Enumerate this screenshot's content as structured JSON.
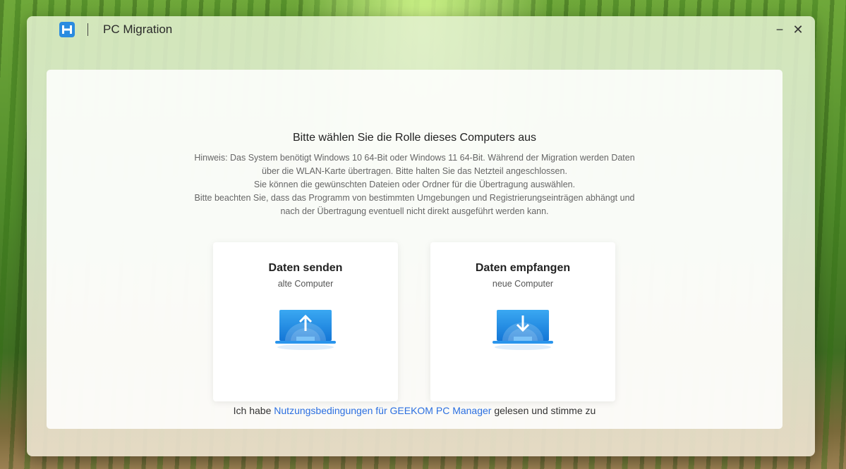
{
  "window": {
    "title": "PC Migration",
    "minimize_label": "−",
    "close_label": "✕",
    "logo_icon": "geekom-h-logo-icon"
  },
  "main": {
    "heading": "Bitte wählen Sie die Rolle dieses Computers aus",
    "hint_lines": [
      "Hinweis: Das System benötigt Windows 10 64-Bit oder Windows 11 64-Bit. Während der Migration werden Daten",
      "über die WLAN-Karte übertragen. Bitte halten Sie das Netzteil angeschlossen.",
      "Sie können die gewünschten Dateien oder Ordner für die Übertragung auswählen.",
      "Bitte beachten Sie, dass das Programm von bestimmten Umgebungen und Registrierungseinträgen abhängt und",
      "nach der Übertragung eventuell nicht direkt ausgeführt werden kann."
    ],
    "cards": [
      {
        "title": "Daten senden",
        "subtitle": "alte Computer",
        "icon": "laptop-upload-icon"
      },
      {
        "title": "Daten empfangen",
        "subtitle": "neue Computer",
        "icon": "laptop-download-icon"
      }
    ],
    "terms": {
      "prefix": "Ich habe ",
      "link": "Nutzungsbedingungen für GEEKOM PC Manager",
      "suffix": " gelesen und stimme zu"
    }
  },
  "colors": {
    "accent": "#2b6fe0",
    "icon_blue": "#1e8ee8"
  }
}
